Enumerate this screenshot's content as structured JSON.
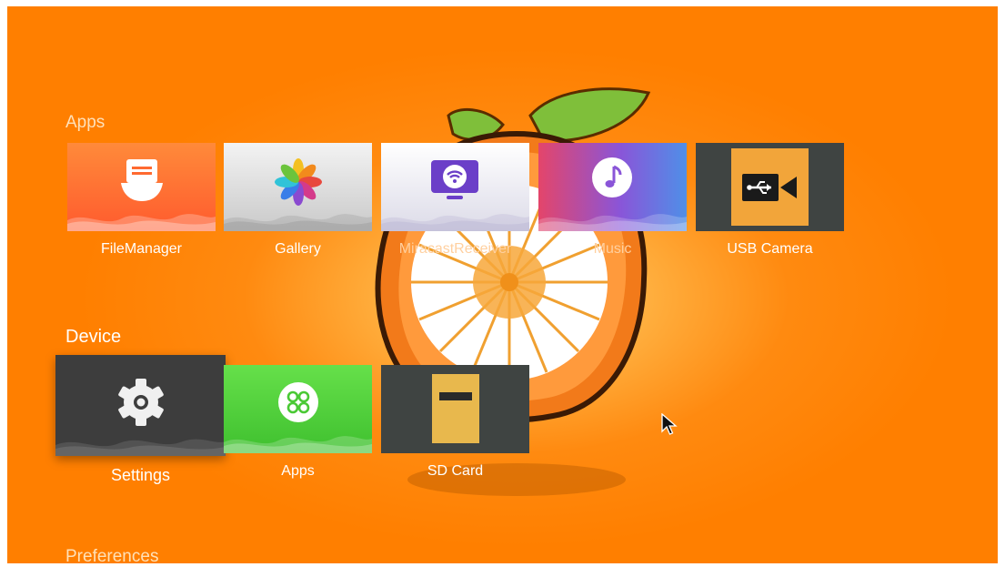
{
  "sections": {
    "apps": "Apps",
    "device": "Device",
    "preferences": "Preferences"
  },
  "apps_row": [
    {
      "label": "FileManager",
      "icon": "folder-icon"
    },
    {
      "label": "Gallery",
      "icon": "pinwheel-icon"
    },
    {
      "label": "MiracastReceiver",
      "icon": "cast-screen-icon"
    },
    {
      "label": "Music",
      "icon": "music-note-icon"
    },
    {
      "label": "USB Camera",
      "icon": "usb-camera-icon"
    }
  ],
  "device_row": [
    {
      "label": "Settings",
      "icon": "gear-icon"
    },
    {
      "label": "Apps",
      "icon": "apps-grid-icon"
    },
    {
      "label": "SD Card",
      "icon": "sd-card-icon"
    }
  ],
  "colors": {
    "background": "#ff7f00",
    "focused_tile": "#3d3d3d",
    "apps_tile": "#59d13f",
    "sd_tile": "#3f4442",
    "sd_card": "#e8b84d"
  }
}
